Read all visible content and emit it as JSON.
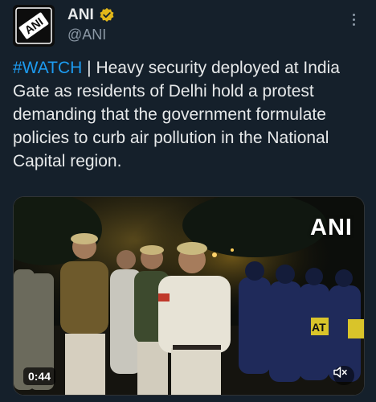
{
  "account": {
    "name": "ANI",
    "handle": "@ANI",
    "avatar_text": "ANI",
    "verified_icon": "verified-badge-icon",
    "verified_color": "#e2b719"
  },
  "tweet": {
    "hashtag": "#WATCH",
    "separator": " | ",
    "body": "Heavy security deployed at India Gate as residents of Delhi hold a protest demanding that the government formulate policies to curb air pollution in the National Capital region."
  },
  "media": {
    "watermark": "ANI",
    "duration": "0:44",
    "sign_text": "AT",
    "mute_icon": "muted-speaker-icon"
  },
  "colors": {
    "background": "#15202b",
    "hashtag": "#1d9bf0",
    "secondary_text": "#8b98a5"
  }
}
